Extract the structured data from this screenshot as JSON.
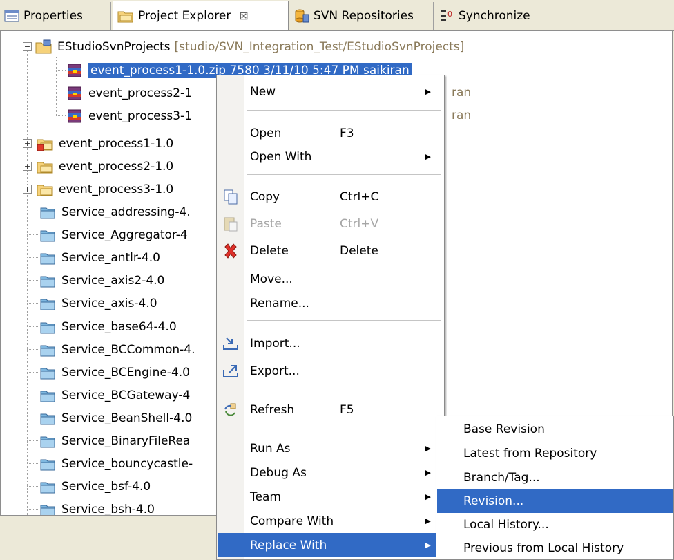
{
  "tabs": [
    {
      "label": "Properties",
      "icon": "properties-icon"
    },
    {
      "label": "Project Explorer",
      "icon": "project-explorer-icon",
      "active": true,
      "close": "⊠"
    },
    {
      "label": "SVN Repositories",
      "icon": "svn-repositories-icon"
    },
    {
      "label": "Synchronize",
      "icon": "synchronize-icon"
    }
  ],
  "tree": {
    "root": {
      "label": "EStudioSvnProjects",
      "decoration": "[studio/SVN_Integration_Test/EStudioSvnProjects]"
    },
    "archives": [
      {
        "label": "event_process1-1.0.zip 7580  3/11/10 5:47 PM  saikiran",
        "selected": true
      },
      {
        "label": "event_process2-1",
        "suffix": "ran"
      },
      {
        "label": "event_process3-1",
        "suffix": "ran"
      }
    ],
    "projects": [
      {
        "label": "event_process1-1.0",
        "error": true
      },
      {
        "label": "event_process2-1.0"
      },
      {
        "label": "event_process3-1.0"
      }
    ],
    "folders": [
      "Service_addressing-4.",
      "Service_Aggregator-4",
      "Service_antlr-4.0",
      "Service_axis2-4.0",
      "Service_axis-4.0",
      "Service_base64-4.0",
      "Service_BCCommon-4.",
      "Service_BCEngine-4.0",
      "Service_BCGateway-4",
      "Service_BeanShell-4.0",
      "Service_BinaryFileRea",
      "Service_bouncycastle-",
      "Service_bsf-4.0",
      "Service_bsh-4.0"
    ]
  },
  "context_menu": {
    "new": "New",
    "open": "Open",
    "open_key": "F3",
    "open_with": "Open With",
    "copy": "Copy",
    "copy_key": "Ctrl+C",
    "paste": "Paste",
    "paste_key": "Ctrl+V",
    "delete": "Delete",
    "delete_key": "Delete",
    "move": "Move...",
    "rename": "Rename...",
    "import": "Import...",
    "export": "Export...",
    "refresh": "Refresh",
    "refresh_key": "F5",
    "run_as": "Run As",
    "debug_as": "Debug As",
    "team": "Team",
    "compare_with": "Compare With",
    "replace_with": "Replace With"
  },
  "submenu": {
    "base_revision": "Base Revision",
    "latest": "Latest from Repository",
    "branch_tag": "Branch/Tag...",
    "revision": "Revision...",
    "local_history": "Local History...",
    "previous_local": "Previous from Local History"
  },
  "colors": {
    "selection": "#316ac5",
    "chrome": "#ece9d8",
    "decoration": "#8a7a5a"
  }
}
